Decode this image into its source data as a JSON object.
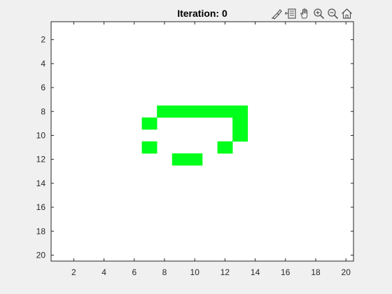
{
  "chart_data": {
    "type": "heatmap",
    "title": "Iteration: 0",
    "xlabel": "",
    "ylabel": "",
    "xlim": [
      0.5,
      20.5
    ],
    "ylim": [
      0.5,
      20.5
    ],
    "y_direction": "reverse",
    "x_ticks": [
      "2",
      "4",
      "6",
      "8",
      "10",
      "12",
      "14",
      "16",
      "18",
      "20"
    ],
    "y_ticks": [
      "2",
      "4",
      "6",
      "8",
      "10",
      "12",
      "14",
      "16",
      "18",
      "20"
    ],
    "grid": false,
    "colors": {
      "live": "#00ff1a",
      "dead": "#ffffff",
      "axis": "#262626"
    },
    "live_cells": [
      {
        "x": 8,
        "y": 8
      },
      {
        "x": 9,
        "y": 8
      },
      {
        "x": 10,
        "y": 8
      },
      {
        "x": 11,
        "y": 8
      },
      {
        "x": 12,
        "y": 8
      },
      {
        "x": 13,
        "y": 8
      },
      {
        "x": 7,
        "y": 9
      },
      {
        "x": 13,
        "y": 9
      },
      {
        "x": 13,
        "y": 10
      },
      {
        "x": 7,
        "y": 11
      },
      {
        "x": 12,
        "y": 11
      },
      {
        "x": 9,
        "y": 12
      },
      {
        "x": 10,
        "y": 12
      }
    ]
  },
  "toolbar": {
    "icons": [
      "brush-icon",
      "data-tips-icon",
      "pan-hand-icon",
      "zoom-in-icon",
      "zoom-out-icon",
      "home-icon"
    ]
  }
}
